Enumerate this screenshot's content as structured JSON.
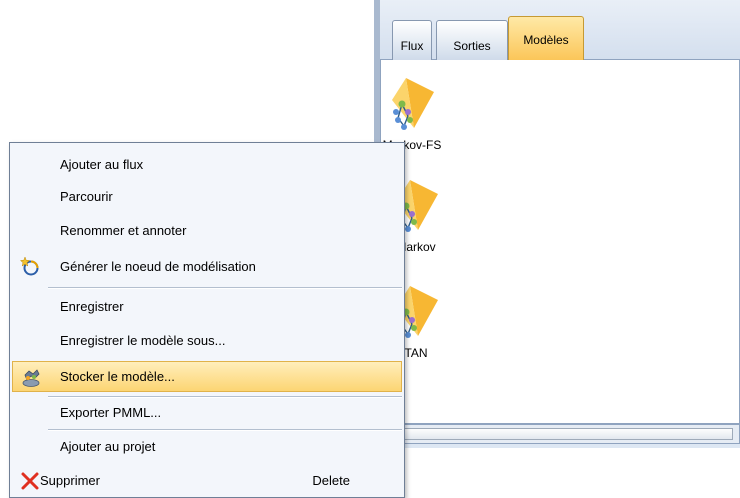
{
  "palette": {
    "tabs": [
      {
        "label": "Flux"
      },
      {
        "label": "Sorties"
      },
      {
        "label": "Modèles"
      }
    ],
    "active_tab": "Modèles",
    "models": [
      {
        "label": "Markov-FS",
        "icon": "bayes-net-model-icon"
      },
      {
        "label": "Markov",
        "icon": "bayes-net-model-icon"
      },
      {
        "label": "TAN",
        "icon": "bayes-net-model-icon"
      }
    ]
  },
  "context_menu": {
    "items": [
      {
        "label": "Ajouter au flux"
      },
      {
        "label": "Parcourir"
      },
      {
        "label": "Renommer et annoter"
      },
      {
        "label": "Générer le noeud de modélisation",
        "icon": "generate-sparkle-icon"
      },
      {
        "label": "Enregistrer"
      },
      {
        "label": "Enregistrer le modèle sous..."
      },
      {
        "label": "Stocker le modèle...",
        "icon": "store-model-icon",
        "highlighted": true
      },
      {
        "label": "Exporter PMML..."
      },
      {
        "label": "Ajouter au projet"
      },
      {
        "label": "Supprimer",
        "icon": "delete-x-icon",
        "shortcut": "Delete"
      }
    ]
  },
  "colors": {
    "highlight": "#fcd573",
    "active_tab": "#fbc557",
    "delete_icon": "#e03020",
    "model_icon": "#f5a623"
  }
}
